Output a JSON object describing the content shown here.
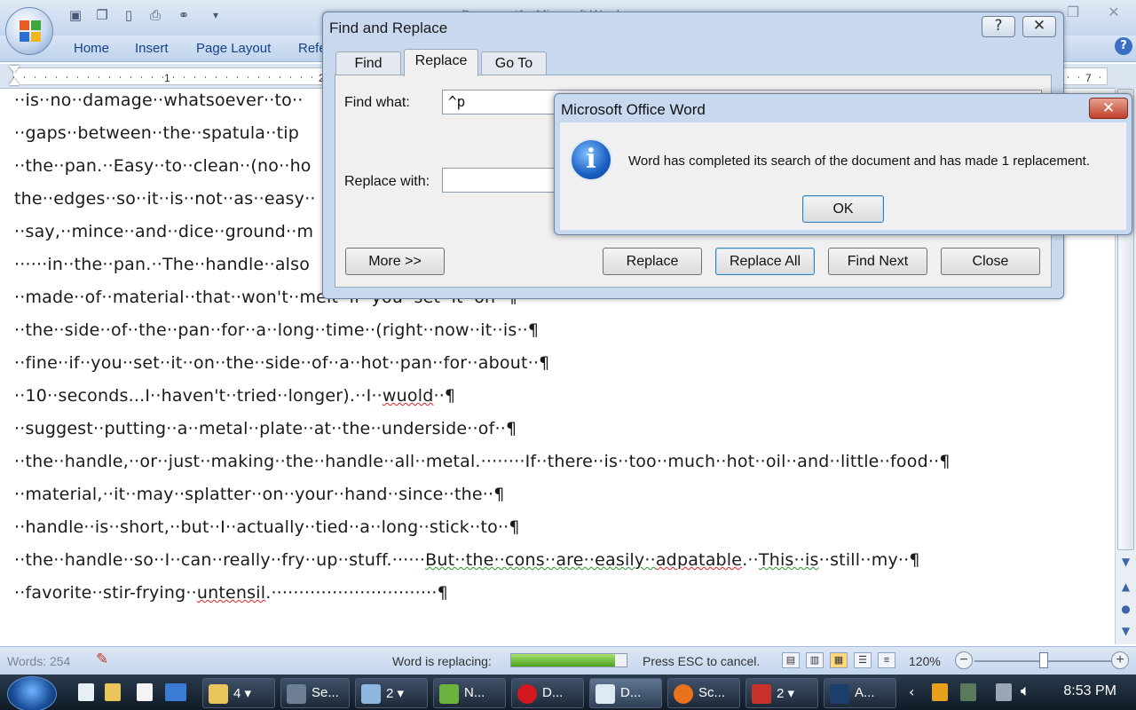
{
  "window": {
    "title": "Document1 - Microsoft Word"
  },
  "ribbon": {
    "tabs": [
      "Home",
      "Insert",
      "Page Layout",
      "Refe"
    ]
  },
  "ruler": {
    "numbers": [
      "1",
      "2",
      "7"
    ]
  },
  "document": {
    "lines": [
      "··is··no··damage··whatsoever··to··",
      "··gaps··between··the··spatula··tip",
      "··the··pan.··Easy··to··clean··(no··ho",
      "the··edges··so··it··is··not··as··easy··",
      "··say,··mince··and··dice··ground··m",
      "······in··the··pan.··The··handle··also",
      "··made··of··material··that··won't··melt··if··you··set··it··on··¶",
      "··the··side··of··the··pan··for··a··long··time··(right··now··it··is··¶",
      "··fine··if··you··set··it··on··the··side··of··a··hot··pan··for··about··¶",
      "··10··seconds...I··haven't··tried··longer).··I··",
      "··suggest··putting··a··metal··plate··at··the··underside··of··¶",
      "··the··handle,··or··just··making··the··handle··all··metal.········If··there··is··too··much··hot··oil··and··little··food··¶",
      "··material,··it··may··splatter··on··your··hand··since··the··¶",
      "··handle··is··short,··but··I··actually··tied··a··long··stick··to··¶",
      "··the··handle··so··I··can··really··fry··up··stuff.······",
      "··favorite··stir-frying··"
    ],
    "line10_misspelled": "wuold",
    "line10_tail": "··¶",
    "line15_grammar": "But··the··cons··are··easily··",
    "line15_misspelled": "adpatable",
    "line15_mid": ".··",
    "line15_grammar2": "This··is",
    "line15_tail": "··still··my··¶",
    "line16_misspelled": "untensil",
    "line16_tail": ".······························¶"
  },
  "status": {
    "words": "Words: 254",
    "replacing": "Word is replacing:",
    "progress": 0.9,
    "esc": "Press ESC to cancel.",
    "zoom": "120%"
  },
  "taskbar": {
    "items": [
      {
        "label": "4",
        "icon": "folder-icon"
      },
      {
        "label": "Se...",
        "icon": "mouse-icon"
      },
      {
        "label": "2",
        "icon": "notepad-icon"
      },
      {
        "label": "N...",
        "icon": "nvidia-icon"
      },
      {
        "label": "D...",
        "icon": "opera-icon"
      },
      {
        "label": "D...",
        "icon": "word-icon"
      },
      {
        "label": "Sc...",
        "icon": "firefox-icon"
      },
      {
        "label": "2",
        "icon": "toolbox-icon"
      },
      {
        "label": "A...",
        "icon": "photoshop-icon"
      }
    ],
    "clock": "8:53 PM"
  },
  "find_replace": {
    "title": "Find and Replace",
    "help": "?",
    "tabs": [
      "Find",
      "Replace",
      "Go To"
    ],
    "find_label": "Find what:",
    "find_value": "^p",
    "replace_label": "Replace with:",
    "replace_value": "",
    "more": "More >>",
    "replace": "Replace",
    "replace_all": "Replace All",
    "find_next": "Find Next",
    "close": "Close"
  },
  "message": {
    "title": "Microsoft Office Word",
    "text": "Word has completed its search of the document and has made 1 replacement.",
    "ok": "OK",
    "icon_letter": "i"
  },
  "colors": {
    "accent": "#15428b",
    "progress": "#4ea31b"
  }
}
